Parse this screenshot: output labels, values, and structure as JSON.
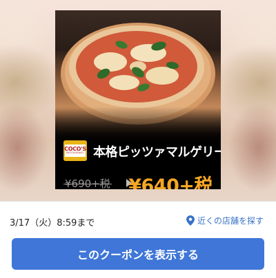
{
  "coupon": {
    "brand_logo_text": "COCO'S",
    "brand_logo_subtext": "RESTAURANT",
    "item_name": "本格ピッツァマルゲリータ",
    "original_price": "¥690+税",
    "sale_price": "¥640+税"
  },
  "footer": {
    "expiry": "3/17（火）8:59まで",
    "store_link_label": "近くの店舗を探す",
    "show_button_label": "このクーポンを表示する"
  },
  "colors": {
    "accent_button": "#3f76d8",
    "sale_price": "#f5a623",
    "link": "#3a73c8"
  },
  "icons": {
    "store_link": "location-pin-icon",
    "price_arrow": "arrow-right-icon"
  }
}
